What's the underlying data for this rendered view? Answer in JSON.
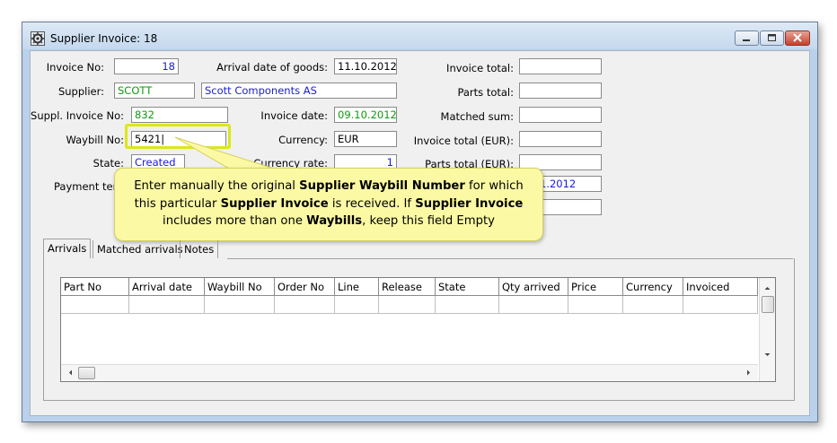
{
  "window": {
    "title": "Supplier Invoice: 18",
    "controls": {
      "minimize": "minimize-icon",
      "maximize": "maximize-icon",
      "close": "close-icon"
    }
  },
  "form": {
    "invoice_no_label": "Invoice No:",
    "invoice_no": "18",
    "supplier_label": "Supplier:",
    "supplier_code": "SCOTT",
    "supplier_name": "Scott Components AS",
    "suppl_invoice_no_label": "Suppl. Invoice No:",
    "suppl_invoice_no": "832",
    "waybill_no_label": "Waybill No:",
    "waybill_no": "5421|",
    "state_label": "State:",
    "state": "Created",
    "payment_terms_label": "Payment term",
    "arrival_date_label": "Arrival date of goods:",
    "arrival_date": "11.10.2012",
    "invoice_date_label": "Invoice date:",
    "invoice_date": "09.10.2012",
    "currency_label": "Currency:",
    "currency": "EUR",
    "currency_rate_label": "Currency rate:",
    "currency_rate": "1",
    "invoice_total_label": "Invoice total:",
    "invoice_total": "",
    "parts_total_label": "Parts total:",
    "parts_total": "",
    "matched_sum_label": "Matched sum:",
    "matched_sum": "",
    "invoice_total_eur_label": "Invoice total (EUR):",
    "invoice_total_eur": "",
    "parts_total_eur_label": "Parts total (EUR):",
    "parts_total_eur": "",
    "due_date_partial": "1.2012",
    "extra_field": ""
  },
  "callout": {
    "t1": "Enter manually the original ",
    "b1": "Supplier Waybill Number",
    "t2": " for which",
    "t3": "this particular ",
    "b2": "Supplier Invoice",
    "t4": " is received.  If ",
    "b3": "Supplier Invoice",
    "t5": "includes more than one ",
    "b4": "Waybills",
    "t6": ", keep this field Empty"
  },
  "tabs": [
    "Arrivals",
    "Matched arrivals",
    "Notes"
  ],
  "table": {
    "columns": [
      "Part No",
      "Arrival date",
      "Waybill No",
      "Order No",
      "Line",
      "Release",
      "State",
      "Qty arrived",
      "Price",
      "Currency",
      "Invoiced"
    ]
  }
}
